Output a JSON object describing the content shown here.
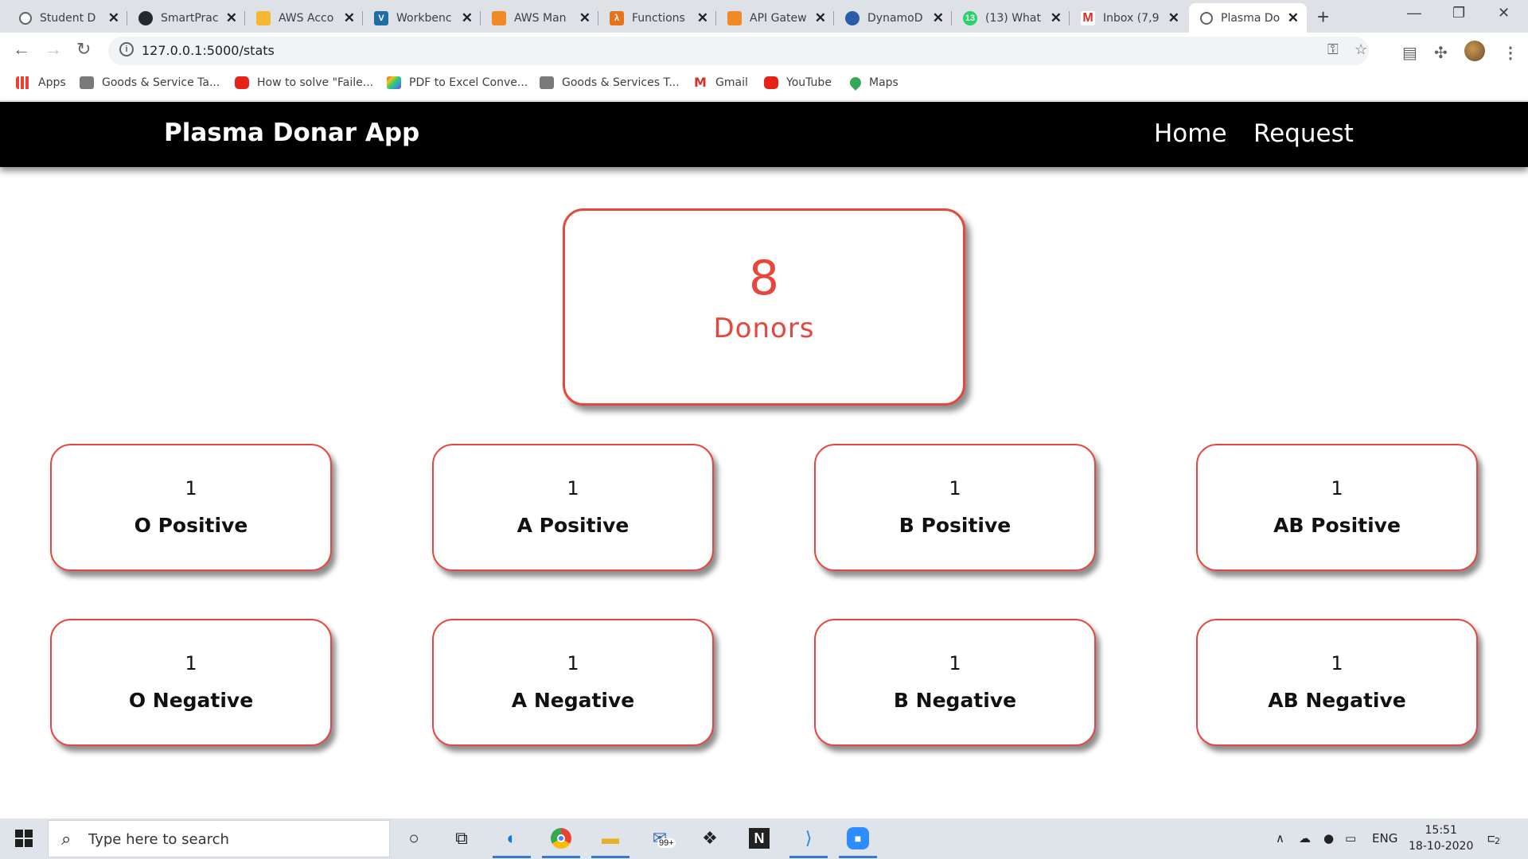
{
  "browser": {
    "tabs": [
      {
        "title": "Student D",
        "icon": "globe-icon",
        "color": "#5f6368"
      },
      {
        "title": "SmartPrac",
        "icon": "github-icon",
        "color": "#24292e"
      },
      {
        "title": "AWS Acco",
        "icon": "aws-icon",
        "color": "#f7b731"
      },
      {
        "title": "Workbenc",
        "icon": "v-icon",
        "color": "#1c6ea4"
      },
      {
        "title": "AWS Man",
        "icon": "aws-cube-icon",
        "color": "#f08a24"
      },
      {
        "title": "Functions",
        "icon": "lambda-icon",
        "color": "#e8721c"
      },
      {
        "title": "API Gatew",
        "icon": "aws-cube-icon",
        "color": "#f08a24"
      },
      {
        "title": "DynamoD",
        "icon": "dynamodb-icon",
        "color": "#2a5caa"
      },
      {
        "title": "(13) What",
        "icon": "whatsapp-icon",
        "color": "#25d366"
      },
      {
        "title": "Inbox (7,9",
        "icon": "gmail-icon",
        "color": "#d93025"
      },
      {
        "title": "Plasma Do",
        "icon": "globe-icon",
        "color": "#5f6368"
      }
    ],
    "url": "127.0.0.1:5000/stats",
    "bookmarks": [
      {
        "label": "Apps",
        "color": "#ea4335"
      },
      {
        "label": "Goods & Service Ta...",
        "color": "#7a7a7a"
      },
      {
        "label": "How to solve \"Faile...",
        "color": "#e62117"
      },
      {
        "label": "PDF to Excel Conve...",
        "color": "#8e44ad"
      },
      {
        "label": "Goods & Services T...",
        "color": "#7a7a7a"
      },
      {
        "label": "Gmail",
        "color": "#d93025"
      },
      {
        "label": "YouTube",
        "color": "#e62117"
      },
      {
        "label": "Maps",
        "color": "#34a853"
      }
    ]
  },
  "app": {
    "brand": "Plasma Donar App",
    "nav": {
      "home": "Home",
      "request": "Request"
    },
    "total": {
      "count": "8",
      "label": "Donors"
    },
    "groups": [
      {
        "count": "1",
        "label": "O Positive"
      },
      {
        "count": "1",
        "label": "A Positive"
      },
      {
        "count": "1",
        "label": "B Positive"
      },
      {
        "count": "1",
        "label": "AB Positive"
      },
      {
        "count": "1",
        "label": "O Negative"
      },
      {
        "count": "1",
        "label": "A Negative"
      },
      {
        "count": "1",
        "label": "B Negative"
      },
      {
        "count": "1",
        "label": "AB Negative"
      }
    ],
    "accent": "#e8453c"
  },
  "taskbar": {
    "search_placeholder": "Type here to search",
    "mail_badge": "99+",
    "lang": "ENG",
    "time": "15:51",
    "date": "18-10-2020",
    "notif_count": "2"
  }
}
